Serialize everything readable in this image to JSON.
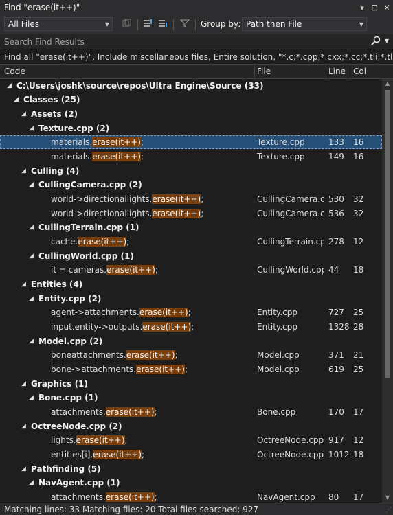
{
  "window": {
    "title": "Find \"erase(it++)\"",
    "btn_menu": "▾",
    "btn_pin": "⊟",
    "btn_close": "✕"
  },
  "toolbar": {
    "scope_value": "All Files",
    "group_by_label": "Group by:",
    "group_by_value": "Path then File"
  },
  "search": {
    "placeholder": "Search Find Results"
  },
  "summary": "Find all \"erase(it++)\", Include miscellaneous files, Entire solution, \"*.c;*.cpp;*.cxx;*.cc;*.tli;*.tlh;*.h;*.hh;*.hp",
  "columns": {
    "code": "Code",
    "file": "File",
    "line": "Line",
    "col": "Col"
  },
  "groups": [
    {
      "level": 0,
      "label": "C:\\Users\\joshk\\source\\repos\\Ultra Engine\\Source",
      "count": "(33)"
    },
    {
      "level": 1,
      "label": "Classes",
      "count": "(25)"
    },
    {
      "level": 2,
      "label": "Assets",
      "count": "(2)"
    },
    {
      "level": 3,
      "label": "Texture.cpp",
      "count": "(2)"
    },
    {
      "level": 2,
      "label": "Culling",
      "count": "(4)"
    },
    {
      "level": 3,
      "label": "CullingCamera.cpp",
      "count": "(2)"
    },
    {
      "level": 3,
      "label": "CullingTerrain.cpp",
      "count": "(1)"
    },
    {
      "level": 3,
      "label": "CullingWorld.cpp",
      "count": "(1)"
    },
    {
      "level": 2,
      "label": "Entities",
      "count": "(4)"
    },
    {
      "level": 3,
      "label": "Entity.cpp",
      "count": "(2)"
    },
    {
      "level": 3,
      "label": "Model.cpp",
      "count": "(2)"
    },
    {
      "level": 2,
      "label": "Graphics",
      "count": "(1)"
    },
    {
      "level": 3,
      "label": "Bone.cpp",
      "count": "(1)"
    },
    {
      "level": 3,
      "label": "OctreeNode.cpp",
      "count": "(2)"
    },
    {
      "level": 2,
      "label": "Pathfinding",
      "count": "(5)"
    },
    {
      "level": 3,
      "label": "NavAgent.cpp",
      "count": "(1)"
    }
  ],
  "results": [
    {
      "pre": "materials.",
      "match": "erase(it++)",
      "post": ";",
      "file": "Texture.cpp",
      "line": "133",
      "col": "16",
      "selected": true
    },
    {
      "pre": "materials.",
      "match": "erase(it++)",
      "post": ";",
      "file": "Texture.cpp",
      "line": "149",
      "col": "16"
    },
    {
      "pre": "world->directionallights.",
      "match": "erase(it++)",
      "post": ";",
      "file": "CullingCamera.c...",
      "line": "530",
      "col": "32"
    },
    {
      "pre": "world->directionallights.",
      "match": "erase(it++)",
      "post": ";",
      "file": "CullingCamera.c...",
      "line": "536",
      "col": "32"
    },
    {
      "pre": "cache.",
      "match": "erase(it++)",
      "post": ";",
      "file": "CullingTerrain.cpp",
      "line": "278",
      "col": "12"
    },
    {
      "pre": "it = cameras.",
      "match": "erase(it++)",
      "post": ";",
      "file": "CullingWorld.cpp",
      "line": "44",
      "col": "18"
    },
    {
      "pre": "agent->attachments.",
      "match": "erase(it++)",
      "post": ";",
      "file": "Entity.cpp",
      "line": "727",
      "col": "25"
    },
    {
      "pre": "input.entity->outputs.",
      "match": "erase(it++)",
      "post": ";",
      "file": "Entity.cpp",
      "line": "1328",
      "col": "28"
    },
    {
      "pre": "boneattachments.",
      "match": "erase(it++)",
      "post": ";",
      "file": "Model.cpp",
      "line": "371",
      "col": "21"
    },
    {
      "pre": "bone->attachments.",
      "match": "erase(it++)",
      "post": ";",
      "file": "Model.cpp",
      "line": "619",
      "col": "25"
    },
    {
      "pre": "attachments.",
      "match": "erase(it++)",
      "post": ";",
      "file": "Bone.cpp",
      "line": "170",
      "col": "17"
    },
    {
      "pre": "lights.",
      "match": "erase(it++)",
      "post": ";",
      "file": "OctreeNode.cpp",
      "line": "917",
      "col": "12"
    },
    {
      "pre": "entities[i].",
      "match": "erase(it++)",
      "post": ";",
      "file": "OctreeNode.cpp",
      "line": "1012",
      "col": "18"
    },
    {
      "pre": "attachments.",
      "match": "erase(it++)",
      "post": ";",
      "file": "NavAgent.cpp",
      "line": "80",
      "col": "17"
    }
  ],
  "status": "Matching lines: 33 Matching files: 20 Total files searched: 927",
  "colors": {
    "highlight": "#7a3e0a",
    "selection": "#264f78",
    "background": "#1e1e1e"
  },
  "icons": [
    "expand-collapse-icon",
    "previous-result-icon",
    "next-result-icon",
    "filter-icon",
    "search-icon"
  ]
}
